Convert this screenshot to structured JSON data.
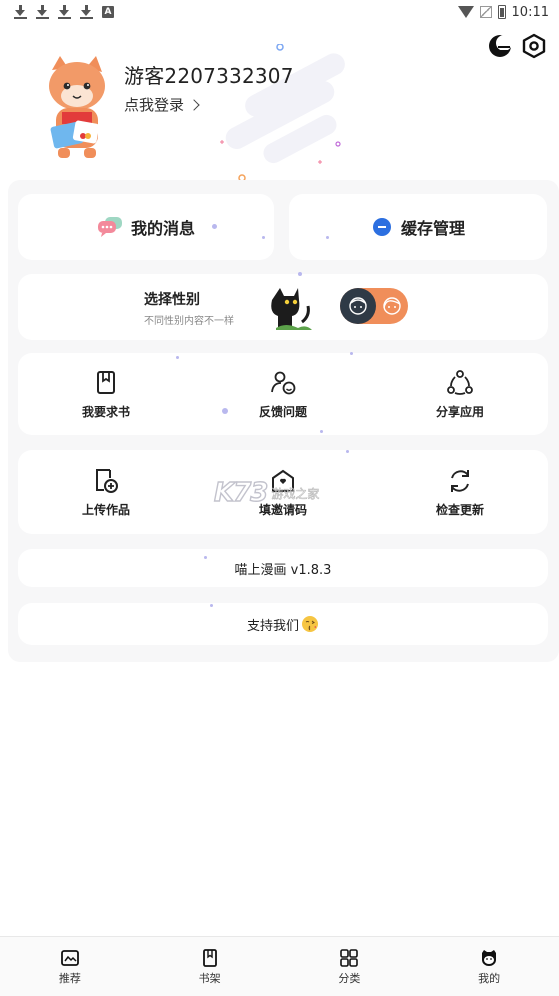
{
  "status_bar": {
    "time": "10:11",
    "icons": [
      "download-icon",
      "download-icon",
      "download-icon",
      "download-icon",
      "a-icon",
      "wifi-icon",
      "no-signal-icon",
      "battery-icon"
    ]
  },
  "header": {
    "username": "游客2207332307",
    "login_text": "点我登录",
    "icons": [
      "theme-icon",
      "settings-icon"
    ]
  },
  "top_buttons": {
    "messages": "我的消息",
    "cache": "缓存管理"
  },
  "gender": {
    "title": "选择性别",
    "subtitle": "不同性别内容不一样"
  },
  "grid1": [
    {
      "label": "我要求书",
      "icon": "book-request-icon"
    },
    {
      "label": "反馈问题",
      "icon": "feedback-icon"
    },
    {
      "label": "分享应用",
      "icon": "share-icon"
    }
  ],
  "grid2": [
    {
      "label": "上传作品",
      "icon": "upload-icon"
    },
    {
      "label": "填邀请码",
      "icon": "invite-code-icon"
    },
    {
      "label": "检查更新",
      "icon": "update-icon"
    }
  ],
  "version_text": "喵上漫画  v1.8.3",
  "support_text": "支持我们",
  "watermark": {
    "logo": "K73",
    "text": "游戏之家"
  },
  "bottom_nav": [
    {
      "label": "推荐",
      "icon": "recommend-icon"
    },
    {
      "label": "书架",
      "icon": "bookshelf-icon"
    },
    {
      "label": "分类",
      "icon": "category-icon"
    },
    {
      "label": "我的",
      "icon": "me-icon"
    }
  ],
  "colors": {
    "accent_orange": "#f08e5a",
    "toggle_dark": "#2f3a46",
    "cache_blue": "#2c6fe0"
  }
}
